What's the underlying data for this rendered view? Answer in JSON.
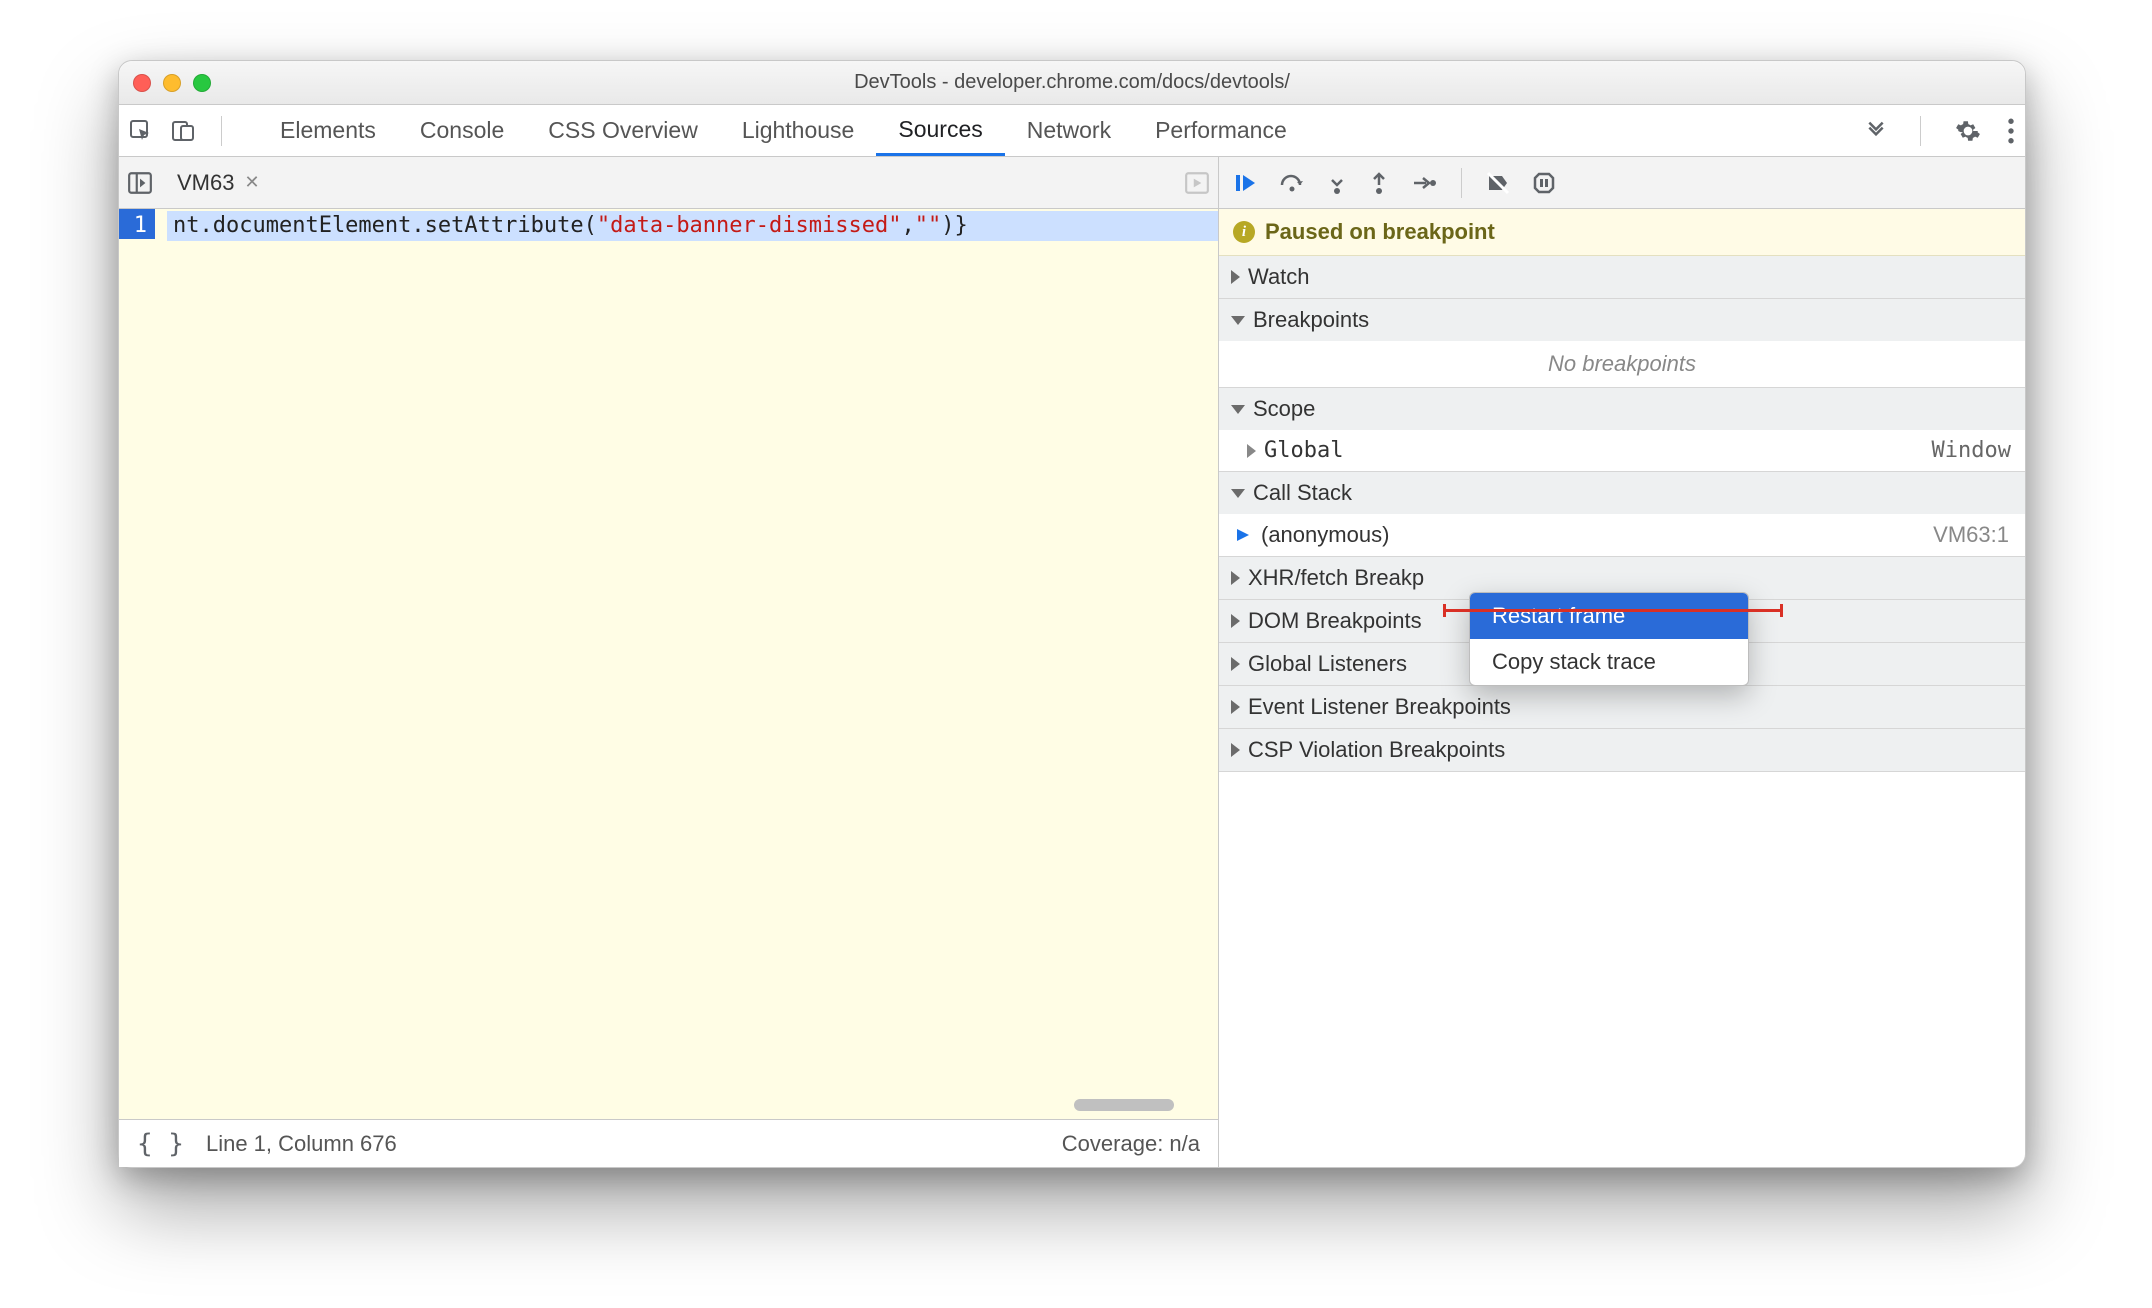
{
  "window": {
    "title": "DevTools - developer.chrome.com/docs/devtools/"
  },
  "panels": {
    "tabs": [
      "Elements",
      "Console",
      "CSS Overview",
      "Lighthouse",
      "Sources",
      "Network",
      "Performance"
    ],
    "active": "Sources"
  },
  "editor": {
    "file_tab": "VM63",
    "line_number": "1",
    "code_prefix": "nt.documentElement.setAttribute(",
    "code_string": "\"data-banner-dismissed\"",
    "code_mid": ",",
    "code_string2": "\"\"",
    "code_suffix": ")}",
    "status_line_col": "Line 1, Column 676",
    "status_coverage": "Coverage: n/a"
  },
  "debugger": {
    "paused_label": "Paused on breakpoint",
    "sections": {
      "watch": "Watch",
      "breakpoints": "Breakpoints",
      "no_breakpoints": "No breakpoints",
      "scope": "Scope",
      "scope_global": "Global",
      "scope_global_val": "Window",
      "callstack": "Call Stack",
      "call_anon": "(anonymous)",
      "call_loc": "VM63:1",
      "xhr": "XHR/fetch Breakp",
      "dom": "DOM Breakpoints",
      "global_listeners": "Global Listeners",
      "event_listener": "Event Listener Breakpoints",
      "csp": "CSP Violation Breakpoints"
    }
  },
  "context_menu": {
    "items": [
      "Restart frame",
      "Copy stack trace"
    ],
    "selected_index": 0
  }
}
